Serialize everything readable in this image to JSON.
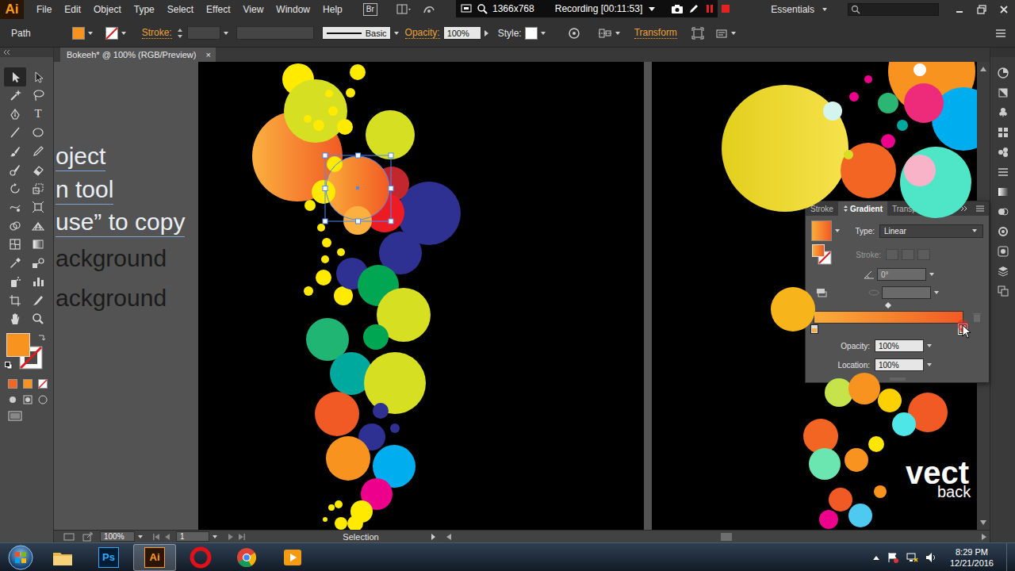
{
  "app": {
    "logo": "Ai"
  },
  "menu": [
    "File",
    "Edit",
    "Object",
    "Type",
    "Select",
    "Effect",
    "View",
    "Window",
    "Help"
  ],
  "bridge": {
    "label": "Br"
  },
  "recorder": {
    "resolution": "1366x768",
    "status": "Recording [00:11:53]"
  },
  "workspace": {
    "label": "Essentials"
  },
  "control_bar": {
    "selection": "Path",
    "fill_color": "#f7931e",
    "stroke_label": "Stroke:",
    "brush": "Basic",
    "opacity_label": "Opacity:",
    "opacity": "100%",
    "style_label": "Style:",
    "transform": "Transform"
  },
  "document_tab": {
    "title": "Bokeeh* @ 100% (RGB/Preview)",
    "close": "×"
  },
  "tools": [
    {
      "kind": "selection",
      "selected": true
    },
    {
      "kind": "direct",
      "selected": false
    },
    {
      "kind": "magic",
      "selected": false
    },
    {
      "kind": "lasso",
      "selected": false
    },
    {
      "kind": "pen",
      "selected": false
    },
    {
      "kind": "type",
      "glyph": "T",
      "selected": false
    },
    {
      "kind": "line",
      "selected": false
    },
    {
      "kind": "ellipse",
      "selected": false
    },
    {
      "kind": "brush",
      "selected": false
    },
    {
      "kind": "pencil",
      "selected": false
    },
    {
      "kind": "blob",
      "selected": false
    },
    {
      "kind": "eraser",
      "selected": false
    },
    {
      "kind": "rotate",
      "selected": false
    },
    {
      "kind": "scale",
      "selected": false
    },
    {
      "kind": "warp",
      "selected": false
    },
    {
      "kind": "free",
      "selected": false
    },
    {
      "kind": "shapebuilder",
      "selected": false
    },
    {
      "kind": "perspective",
      "selected": false
    },
    {
      "kind": "mesh",
      "selected": false
    },
    {
      "kind": "gradient",
      "selected": false
    },
    {
      "kind": "eyedropper",
      "selected": false
    },
    {
      "kind": "blend",
      "selected": false
    },
    {
      "kind": "symbol",
      "selected": false
    },
    {
      "kind": "graph",
      "selected": false
    },
    {
      "kind": "artboard",
      "selected": false
    },
    {
      "kind": "slice",
      "selected": false
    },
    {
      "kind": "hand",
      "selected": false
    },
    {
      "kind": "zoom",
      "selected": false
    }
  ],
  "canvas_notes": [
    {
      "text": "oject",
      "kind": "light"
    },
    {
      "text": "n tool",
      "kind": "light"
    },
    {
      "text": "use” to copy",
      "kind": "light"
    },
    {
      "text": "ackground",
      "kind": "dark"
    },
    {
      "text": "ackground",
      "kind": "dark"
    }
  ],
  "reference_image": {
    "lines": [
      "vect",
      "back"
    ]
  },
  "gradient_panel": {
    "tabs": [
      {
        "label": "Stroke",
        "selected": false
      },
      {
        "label": "Gradient",
        "selected": true
      },
      {
        "label": "Transparency",
        "selected": false
      }
    ],
    "type_label": "Type:",
    "type": "Linear",
    "stroke_label": "Stroke:",
    "angle": "0°",
    "opacity_label": "Opacity:",
    "opacity": "100%",
    "location_label": "Location:",
    "location": "100%",
    "stops": [
      {
        "level": 0,
        "selected": false,
        "color": "#fbac3a"
      },
      {
        "level": 1,
        "selected": true,
        "color": "#f15a24"
      }
    ]
  },
  "status_bar": {
    "zoom": "100%",
    "artboard": "1",
    "tool": "Selection"
  },
  "taskbar": {
    "apps": [
      {
        "kind": "explorer",
        "active": false
      },
      {
        "kind": "photoshop",
        "glyph": "Ps",
        "active": false
      },
      {
        "kind": "illustrator",
        "glyph": "Ai",
        "active": true
      },
      {
        "kind": "opera",
        "active": false
      },
      {
        "kind": "chrome",
        "active": false
      },
      {
        "kind": "media",
        "active": false
      }
    ],
    "time": "8:29 PM",
    "date": "12/21/2016"
  }
}
